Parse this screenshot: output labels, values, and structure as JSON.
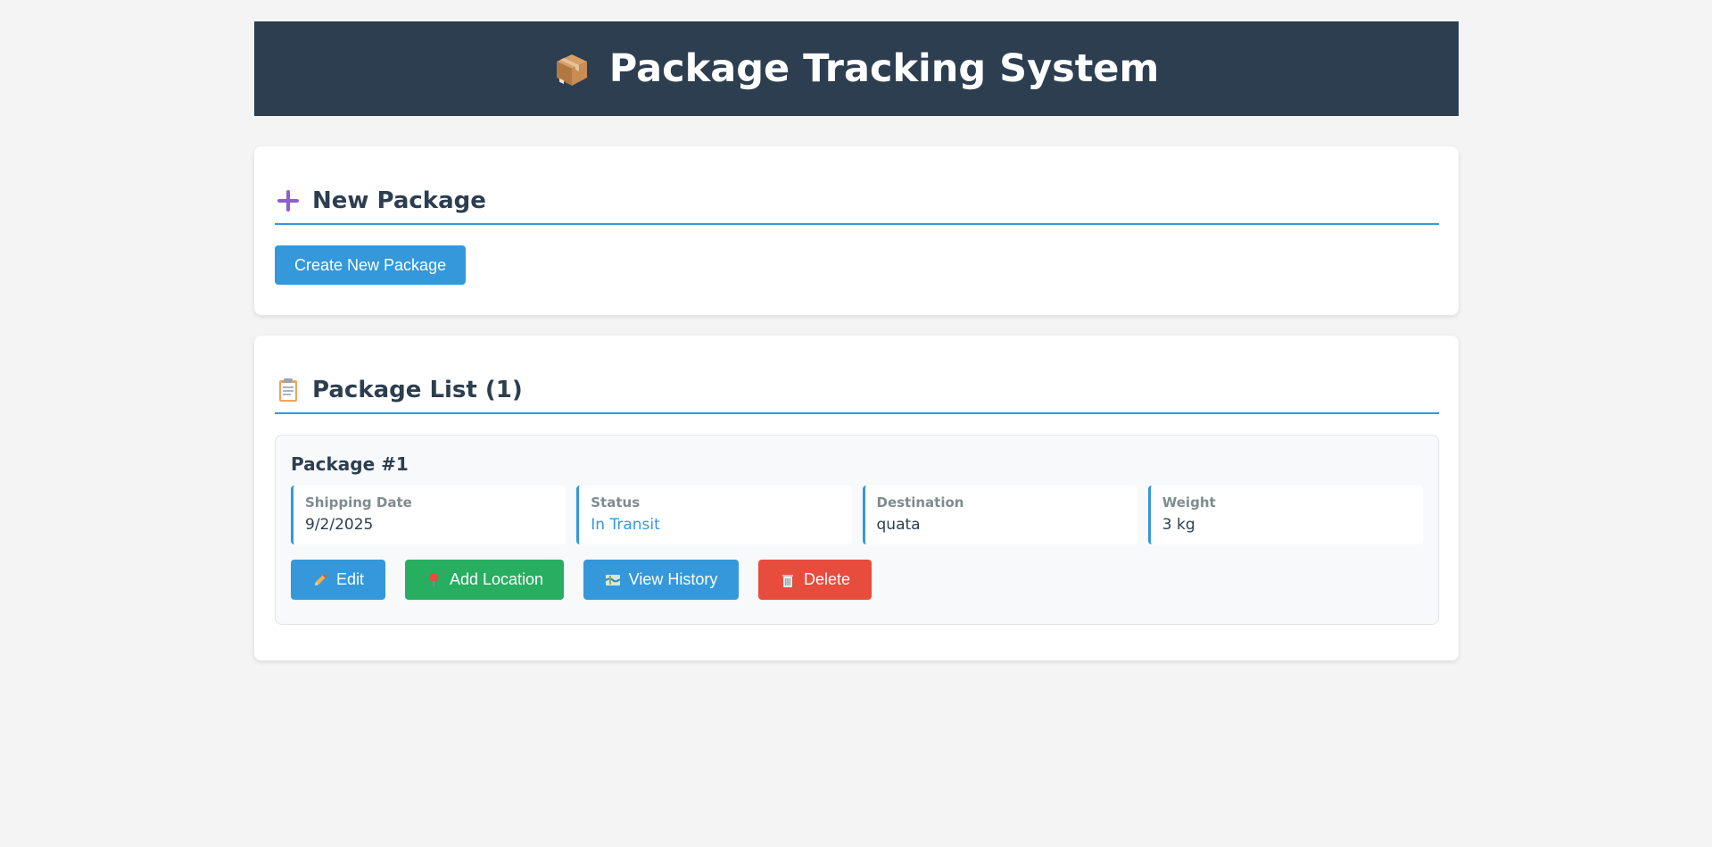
{
  "header": {
    "title": "Package Tracking System",
    "icon": "package-icon"
  },
  "new_package": {
    "title": "New Package",
    "icon": "plus-icon",
    "create_button": "Create New Package"
  },
  "package_list": {
    "title": "Package List (1)",
    "icon": "clipboard-icon",
    "packages": [
      {
        "title": "Package #1",
        "fields": [
          {
            "label": "Shipping Date",
            "value": "9/2/2025"
          },
          {
            "label": "Status",
            "value": "In Transit"
          },
          {
            "label": "Destination",
            "value": "quata"
          },
          {
            "label": "Weight",
            "value": "3 kg"
          }
        ],
        "actions": {
          "edit": "Edit",
          "add_location": "Add Location",
          "view_history": "View History",
          "delete": "Delete"
        }
      }
    ]
  },
  "colors": {
    "header_bg": "#2c3e50",
    "accent": "#3498db",
    "success": "#27ae60",
    "danger": "#e74c3c",
    "page_bg": "#f4f4f4"
  }
}
